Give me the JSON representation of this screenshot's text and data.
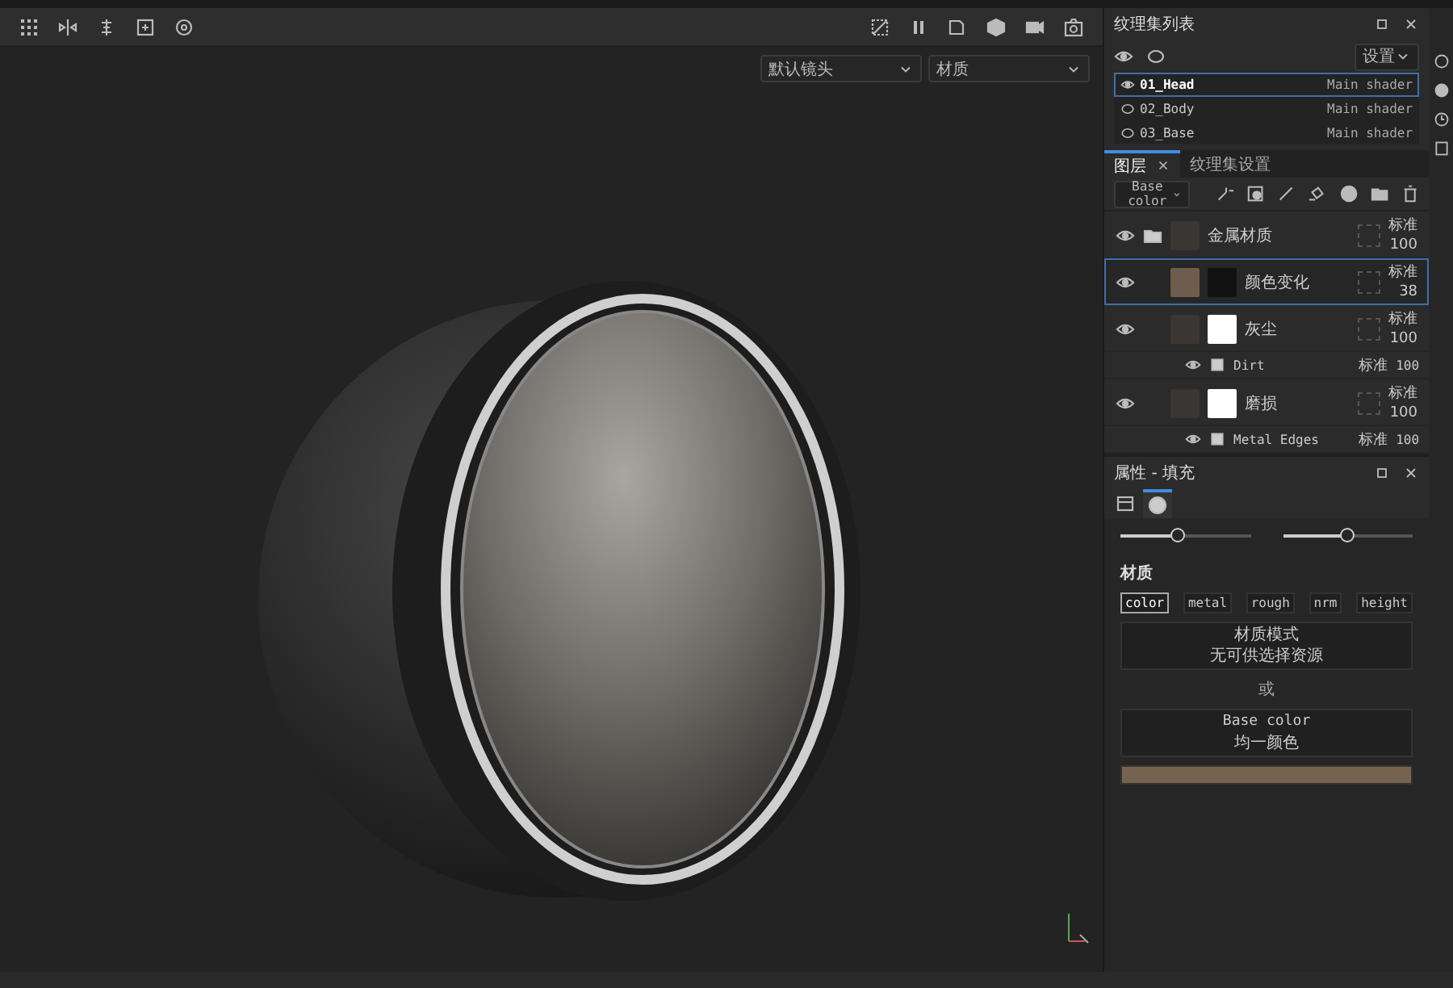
{
  "viewport": {
    "camera_dropdown": "默认镜头",
    "mode_dropdown": "材质"
  },
  "texture_sets": {
    "title": "纹理集列表",
    "settings_dropdown": "设置",
    "items": [
      {
        "name": "01_Head",
        "shader": "Main shader",
        "selected": true,
        "visible": true
      },
      {
        "name": "02_Body",
        "shader": "Main shader",
        "selected": false,
        "visible": false
      },
      {
        "name": "03_Base",
        "shader": "Main shader",
        "selected": false,
        "visible": false
      }
    ]
  },
  "layers": {
    "tabs": [
      {
        "label": "图层",
        "selected": true
      },
      {
        "label": "纹理集设置",
        "selected": false
      }
    ],
    "channel_dropdown": "Base color",
    "items": [
      {
        "kind": "folder",
        "name": "金属材质",
        "blend": "标准",
        "opacity": "100",
        "selected": false
      },
      {
        "kind": "fill",
        "name": "颜色变化",
        "blend": "标准",
        "opacity": "38",
        "selected": true
      },
      {
        "kind": "masked",
        "name": "灰尘",
        "blend": "标准",
        "opacity": "100",
        "selected": false,
        "children": [
          {
            "name": "Dirt",
            "blend": "标准",
            "opacity": "100"
          }
        ]
      },
      {
        "kind": "masked",
        "name": "磨损",
        "blend": "标准",
        "opacity": "100",
        "selected": false,
        "children": [
          {
            "name": "Metal Edges",
            "blend": "标准",
            "opacity": "100"
          }
        ]
      }
    ]
  },
  "properties": {
    "title": "属性 - 填充",
    "tabs": [
      {
        "selected": false
      },
      {
        "selected": true
      }
    ],
    "sliders": [
      {
        "level": 0.45
      },
      {
        "level": 0.5
      }
    ],
    "section": "材质",
    "channels": [
      {
        "label": "color",
        "selected": true
      },
      {
        "label": "metal",
        "selected": false
      },
      {
        "label": "rough",
        "selected": false
      },
      {
        "label": "nrm",
        "selected": false
      },
      {
        "label": "height",
        "selected": false
      }
    ],
    "material_mode": {
      "title": "材质模式",
      "value": "无可供选择资源"
    },
    "or_label": "或",
    "base_color": {
      "title": "Base color",
      "value": "均一颜色",
      "color": "#76634f"
    }
  }
}
